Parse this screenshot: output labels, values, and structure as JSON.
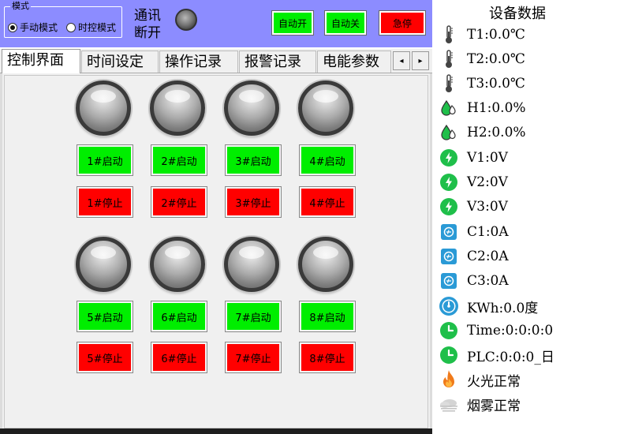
{
  "mode": {
    "title": "模式",
    "options": [
      "手动模式",
      "时控模式"
    ],
    "selected": 0
  },
  "comm": {
    "label": "通讯断开",
    "lamp_color": "#7a7a7a"
  },
  "top_buttons": {
    "auto_on": "自动开",
    "auto_off": "自动关",
    "estop": "急停"
  },
  "tabs": [
    "控制界面",
    "时间设定",
    "操作记录",
    "报警记录",
    "电能参数"
  ],
  "active_tab": 0,
  "scroll": {
    "left": "◂",
    "right": "▸"
  },
  "motors": [
    {
      "start": "1#启动",
      "stop": "1#停止"
    },
    {
      "start": "2#启动",
      "stop": "2#停止"
    },
    {
      "start": "3#启动",
      "stop": "3#停止"
    },
    {
      "start": "4#启动",
      "stop": "4#停止"
    },
    {
      "start": "5#启动",
      "stop": "5#停止"
    },
    {
      "start": "6#启动",
      "stop": "6#停止"
    },
    {
      "start": "7#启动",
      "stop": "7#停止"
    },
    {
      "start": "8#启动",
      "stop": "8#停止"
    }
  ],
  "device_data": {
    "title": "设备数据",
    "rows": [
      {
        "icon": "thermometer-icon",
        "value": "T1:0.0℃"
      },
      {
        "icon": "thermometer-icon",
        "value": "T2:0.0℃"
      },
      {
        "icon": "thermometer-icon",
        "value": "T3:0.0℃"
      },
      {
        "icon": "humidity-icon",
        "value": "H1:0.0%"
      },
      {
        "icon": "humidity-icon",
        "value": "H2:0.0%"
      },
      {
        "icon": "voltage-icon",
        "value": "V1:0V"
      },
      {
        "icon": "voltage-icon",
        "value": "V2:0V"
      },
      {
        "icon": "voltage-icon",
        "value": "V3:0V"
      },
      {
        "icon": "current-icon",
        "value": "C1:0A"
      },
      {
        "icon": "current-icon",
        "value": "C2:0A"
      },
      {
        "icon": "current-icon",
        "value": "C3:0A"
      },
      {
        "icon": "gauge-icon",
        "value": "KWh:0.0度"
      },
      {
        "icon": "clock-icon",
        "value": "Time:0:0:0:0"
      },
      {
        "icon": "clock-icon",
        "value": "PLC:0:0:0_日"
      },
      {
        "icon": "fire-icon",
        "value": "火光正常"
      },
      {
        "icon": "smoke-icon",
        "value": "烟雾正常"
      }
    ]
  },
  "colors": {
    "header_bg": "#8c8cff",
    "start_green": "#00ee00",
    "stop_red": "#ff0000",
    "icon_green": "#1fbf4a",
    "icon_blue": "#2a9ad6"
  }
}
